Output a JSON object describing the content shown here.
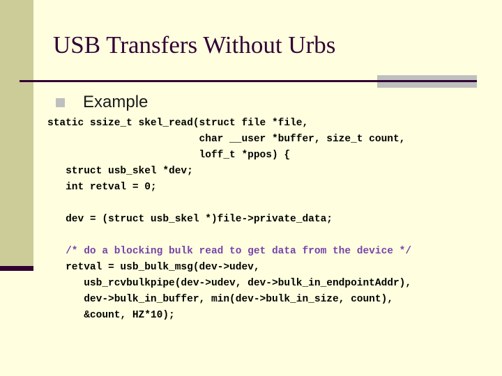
{
  "slide": {
    "title": "USB Transfers Without Urbs",
    "bullet": {
      "marker_icon": "square-bullet-icon",
      "label": "Example"
    },
    "colors": {
      "background": "#FFFFE0",
      "side_band": "#CCCC99",
      "side_band_foot": "#330033",
      "title_text": "#330033",
      "title_rule": "#330033",
      "title_accent": "#BFBFBF",
      "bullet_marker": "#BFBFBF",
      "bullet_label": "#1A1A1A",
      "code_text": "#000000",
      "code_comment": "#7744AA"
    },
    "code": [
      {
        "text": "static ssize_t skel_read(struct file *file,",
        "kind": "code"
      },
      {
        "text": "                         char __user *buffer, size_t count,",
        "kind": "code"
      },
      {
        "text": "                         loff_t *ppos) {",
        "kind": "code"
      },
      {
        "text": "   struct usb_skel *dev;",
        "kind": "code"
      },
      {
        "text": "   int retval = 0;",
        "kind": "code"
      },
      {
        "text": "",
        "kind": "blank"
      },
      {
        "text": "   dev = (struct usb_skel *)file->private_data;",
        "kind": "code"
      },
      {
        "text": "",
        "kind": "blank"
      },
      {
        "text": "   /* do a blocking bulk read to get data from the device */",
        "kind": "comment"
      },
      {
        "text": "   retval = usb_bulk_msg(dev->udev,",
        "kind": "code"
      },
      {
        "text": "      usb_rcvbulkpipe(dev->udev, dev->bulk_in_endpointAddr),",
        "kind": "code"
      },
      {
        "text": "      dev->bulk_in_buffer, min(dev->bulk_in_size, count),",
        "kind": "code"
      },
      {
        "text": "      &count, HZ*10);",
        "kind": "code"
      }
    ]
  }
}
